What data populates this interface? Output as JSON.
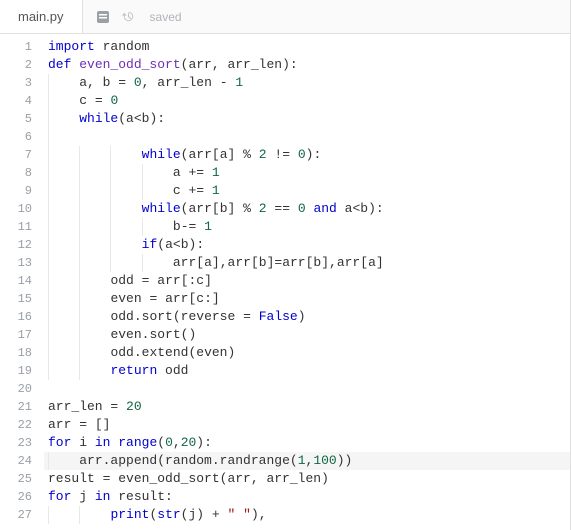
{
  "tab": {
    "filename": "main.py"
  },
  "toolbar": {
    "saved_label": "saved"
  },
  "editor": {
    "highlighted_line": 24,
    "lines": [
      {
        "n": 1,
        "indent": 0,
        "tokens": [
          [
            "kw",
            "import"
          ],
          [
            "",
            " random"
          ]
        ]
      },
      {
        "n": 2,
        "indent": 0,
        "tokens": [
          [
            "kw",
            "def"
          ],
          [
            "",
            " "
          ],
          [
            "fn",
            "even_odd_sort"
          ],
          [
            "par",
            "("
          ],
          [
            "",
            "arr, arr_len"
          ],
          [
            "par",
            ")"
          ],
          [
            "",
            ":"
          ]
        ]
      },
      {
        "n": 3,
        "indent": 1,
        "tokens": [
          [
            "",
            "a, b "
          ],
          [
            "op",
            "="
          ],
          [
            "",
            " "
          ],
          [
            "num",
            "0"
          ],
          [
            "",
            ", arr_len "
          ],
          [
            "op",
            "-"
          ],
          [
            "",
            " "
          ],
          [
            "num",
            "1"
          ]
        ]
      },
      {
        "n": 4,
        "indent": 1,
        "tokens": [
          [
            "",
            "c "
          ],
          [
            "op",
            "="
          ],
          [
            "",
            " "
          ],
          [
            "num",
            "0"
          ]
        ]
      },
      {
        "n": 5,
        "indent": 1,
        "tokens": [
          [
            "kw",
            "while"
          ],
          [
            "par",
            "("
          ],
          [
            "",
            "a"
          ],
          [
            "op",
            "<"
          ],
          [
            "",
            "b"
          ],
          [
            "par",
            ")"
          ],
          [
            "",
            ":"
          ]
        ]
      },
      {
        "n": 6,
        "indent": 1,
        "tokens": []
      },
      {
        "n": 7,
        "indent": 3,
        "tokens": [
          [
            "kw",
            "while"
          ],
          [
            "par",
            "("
          ],
          [
            "",
            "arr"
          ],
          [
            "par",
            "["
          ],
          [
            "",
            "a"
          ],
          [
            "par",
            "]"
          ],
          [
            "",
            " "
          ],
          [
            "op",
            "%"
          ],
          [
            "",
            " "
          ],
          [
            "num",
            "2"
          ],
          [
            "",
            " "
          ],
          [
            "op",
            "!="
          ],
          [
            "",
            " "
          ],
          [
            "num",
            "0"
          ],
          [
            "par",
            ")"
          ],
          [
            "",
            ":"
          ]
        ]
      },
      {
        "n": 8,
        "indent": 4,
        "tokens": [
          [
            "",
            "a "
          ],
          [
            "op",
            "+="
          ],
          [
            "",
            " "
          ],
          [
            "num",
            "1"
          ]
        ]
      },
      {
        "n": 9,
        "indent": 4,
        "tokens": [
          [
            "",
            "c "
          ],
          [
            "op",
            "+="
          ],
          [
            "",
            " "
          ],
          [
            "num",
            "1"
          ]
        ]
      },
      {
        "n": 10,
        "indent": 3,
        "tokens": [
          [
            "kw",
            "while"
          ],
          [
            "par",
            "("
          ],
          [
            "",
            "arr"
          ],
          [
            "par",
            "["
          ],
          [
            "",
            "b"
          ],
          [
            "par",
            "]"
          ],
          [
            "",
            " "
          ],
          [
            "op",
            "%"
          ],
          [
            "",
            " "
          ],
          [
            "num",
            "2"
          ],
          [
            "",
            " "
          ],
          [
            "op",
            "=="
          ],
          [
            "",
            " "
          ],
          [
            "num",
            "0"
          ],
          [
            "",
            " "
          ],
          [
            "kw",
            "and"
          ],
          [
            "",
            " a"
          ],
          [
            "op",
            "<"
          ],
          [
            "",
            "b"
          ],
          [
            "par",
            ")"
          ],
          [
            "",
            ":"
          ]
        ]
      },
      {
        "n": 11,
        "indent": 4,
        "tokens": [
          [
            "",
            "b"
          ],
          [
            "op",
            "-="
          ],
          [
            "",
            " "
          ],
          [
            "num",
            "1"
          ]
        ]
      },
      {
        "n": 12,
        "indent": 3,
        "tokens": [
          [
            "kw",
            "if"
          ],
          [
            "par",
            "("
          ],
          [
            "",
            "a"
          ],
          [
            "op",
            "<"
          ],
          [
            "",
            "b"
          ],
          [
            "par",
            ")"
          ],
          [
            "",
            ":"
          ]
        ]
      },
      {
        "n": 13,
        "indent": 4,
        "tokens": [
          [
            "",
            "arr"
          ],
          [
            "par",
            "["
          ],
          [
            "",
            "a"
          ],
          [
            "par",
            "]"
          ],
          [
            "",
            ",arr"
          ],
          [
            "par",
            "["
          ],
          [
            "",
            "b"
          ],
          [
            "par",
            "]"
          ],
          [
            "op",
            "="
          ],
          [
            "",
            "arr"
          ],
          [
            "par",
            "["
          ],
          [
            "",
            "b"
          ],
          [
            "par",
            "]"
          ],
          [
            "",
            ",arr"
          ],
          [
            "par",
            "["
          ],
          [
            "",
            "a"
          ],
          [
            "par",
            "]"
          ]
        ]
      },
      {
        "n": 14,
        "indent": 2,
        "tokens": [
          [
            "",
            "odd "
          ],
          [
            "op",
            "="
          ],
          [
            "",
            " arr"
          ],
          [
            "par",
            "["
          ],
          [
            "",
            ":c"
          ],
          [
            "par",
            "]"
          ]
        ]
      },
      {
        "n": 15,
        "indent": 2,
        "tokens": [
          [
            "",
            "even "
          ],
          [
            "op",
            "="
          ],
          [
            "",
            " arr"
          ],
          [
            "par",
            "["
          ],
          [
            "",
            "c:"
          ],
          [
            "par",
            "]"
          ]
        ]
      },
      {
        "n": 16,
        "indent": 2,
        "tokens": [
          [
            "",
            "odd.sort"
          ],
          [
            "par",
            "("
          ],
          [
            "",
            "reverse "
          ],
          [
            "op",
            "="
          ],
          [
            "",
            " "
          ],
          [
            "kw",
            "False"
          ],
          [
            "par",
            ")"
          ]
        ]
      },
      {
        "n": 17,
        "indent": 2,
        "tokens": [
          [
            "",
            "even.sort"
          ],
          [
            "par",
            "()"
          ]
        ]
      },
      {
        "n": 18,
        "indent": 2,
        "tokens": [
          [
            "",
            "odd.extend"
          ],
          [
            "par",
            "("
          ],
          [
            "",
            "even"
          ],
          [
            "par",
            ")"
          ]
        ]
      },
      {
        "n": 19,
        "indent": 2,
        "tokens": [
          [
            "kw",
            "return"
          ],
          [
            "",
            " odd"
          ]
        ]
      },
      {
        "n": 20,
        "indent": 0,
        "tokens": []
      },
      {
        "n": 21,
        "indent": 0,
        "tokens": [
          [
            "",
            "arr_len "
          ],
          [
            "op",
            "="
          ],
          [
            "",
            " "
          ],
          [
            "num",
            "20"
          ]
        ]
      },
      {
        "n": 22,
        "indent": 0,
        "tokens": [
          [
            "",
            "arr "
          ],
          [
            "op",
            "="
          ],
          [
            "",
            " "
          ],
          [
            "par",
            "[]"
          ]
        ]
      },
      {
        "n": 23,
        "indent": 0,
        "tokens": [
          [
            "kw",
            "for"
          ],
          [
            "",
            " i "
          ],
          [
            "kw",
            "in"
          ],
          [
            "",
            " "
          ],
          [
            "builtin",
            "range"
          ],
          [
            "par",
            "("
          ],
          [
            "num",
            "0"
          ],
          [
            "",
            ","
          ],
          [
            "num",
            "20"
          ],
          [
            "par",
            ")"
          ],
          [
            "",
            ":"
          ]
        ]
      },
      {
        "n": 24,
        "indent": 1,
        "tokens": [
          [
            "",
            "arr.append"
          ],
          [
            "par",
            "("
          ],
          [
            "",
            "random.randrange"
          ],
          [
            "par",
            "("
          ],
          [
            "num",
            "1"
          ],
          [
            "",
            ","
          ],
          [
            "num",
            "100"
          ],
          [
            "par",
            "))"
          ]
        ]
      },
      {
        "n": 25,
        "indent": 0,
        "tokens": [
          [
            "",
            "result "
          ],
          [
            "op",
            "="
          ],
          [
            "",
            " even_odd_sort"
          ],
          [
            "par",
            "("
          ],
          [
            "",
            "arr, arr_len"
          ],
          [
            "par",
            ")"
          ]
        ]
      },
      {
        "n": 26,
        "indent": 0,
        "tokens": [
          [
            "kw",
            "for"
          ],
          [
            "",
            " j "
          ],
          [
            "kw",
            "in"
          ],
          [
            "",
            " result:"
          ]
        ]
      },
      {
        "n": 27,
        "indent": 2,
        "tokens": [
          [
            "builtin",
            "print"
          ],
          [
            "par",
            "("
          ],
          [
            "builtin",
            "str"
          ],
          [
            "par",
            "("
          ],
          [
            "",
            "j"
          ],
          [
            "par",
            ")"
          ],
          [
            "",
            " "
          ],
          [
            "op",
            "+"
          ],
          [
            "",
            " "
          ],
          [
            "str",
            "\" \""
          ],
          [
            "par",
            ")"
          ],
          [
            "",
            ","
          ]
        ]
      }
    ]
  }
}
